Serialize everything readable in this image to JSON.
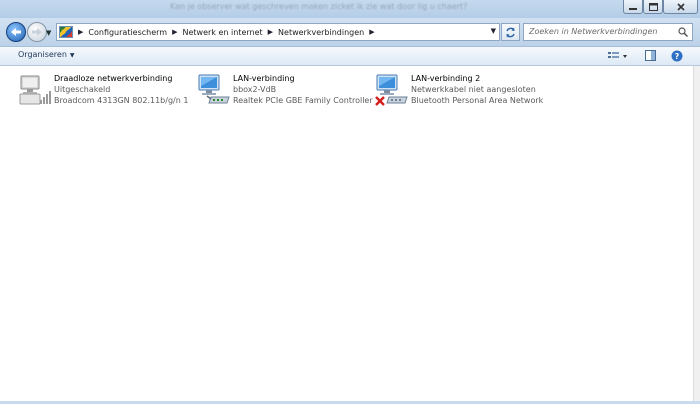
{
  "window": {
    "title": "Kan je observer wat geschreven maken zicket ik zie wat door lig u chaert?"
  },
  "breadcrumb": [
    "Configuratiescherm",
    "Netwerk en internet",
    "Netwerkverbindingen"
  ],
  "search": {
    "placeholder": "Zoeken in Netwerkverbindingen"
  },
  "toolbar": {
    "organize_label": "Organiseren"
  },
  "connections": [
    {
      "name": "Draadloze netwerkverbinding",
      "status": "Uitgeschakeld",
      "device": "Broadcom 4313GN 802.11b/g/n 1...",
      "icon": "wireless-network-icon"
    },
    {
      "name": "LAN-verbinding",
      "status": "bbox2-VdB",
      "device": "Realtek PCIe GBE Family Controller",
      "icon": "lan-network-icon"
    },
    {
      "name": "LAN-verbinding 2",
      "status": "Netwerkkabel niet aangesloten",
      "device": "Bluetooth Personal Area Network",
      "icon": "lan-disconnected-icon"
    }
  ],
  "colors": {
    "accent": "#1d5fb0",
    "titlebar": "#c5d9ee",
    "error": "#d41f1f"
  }
}
